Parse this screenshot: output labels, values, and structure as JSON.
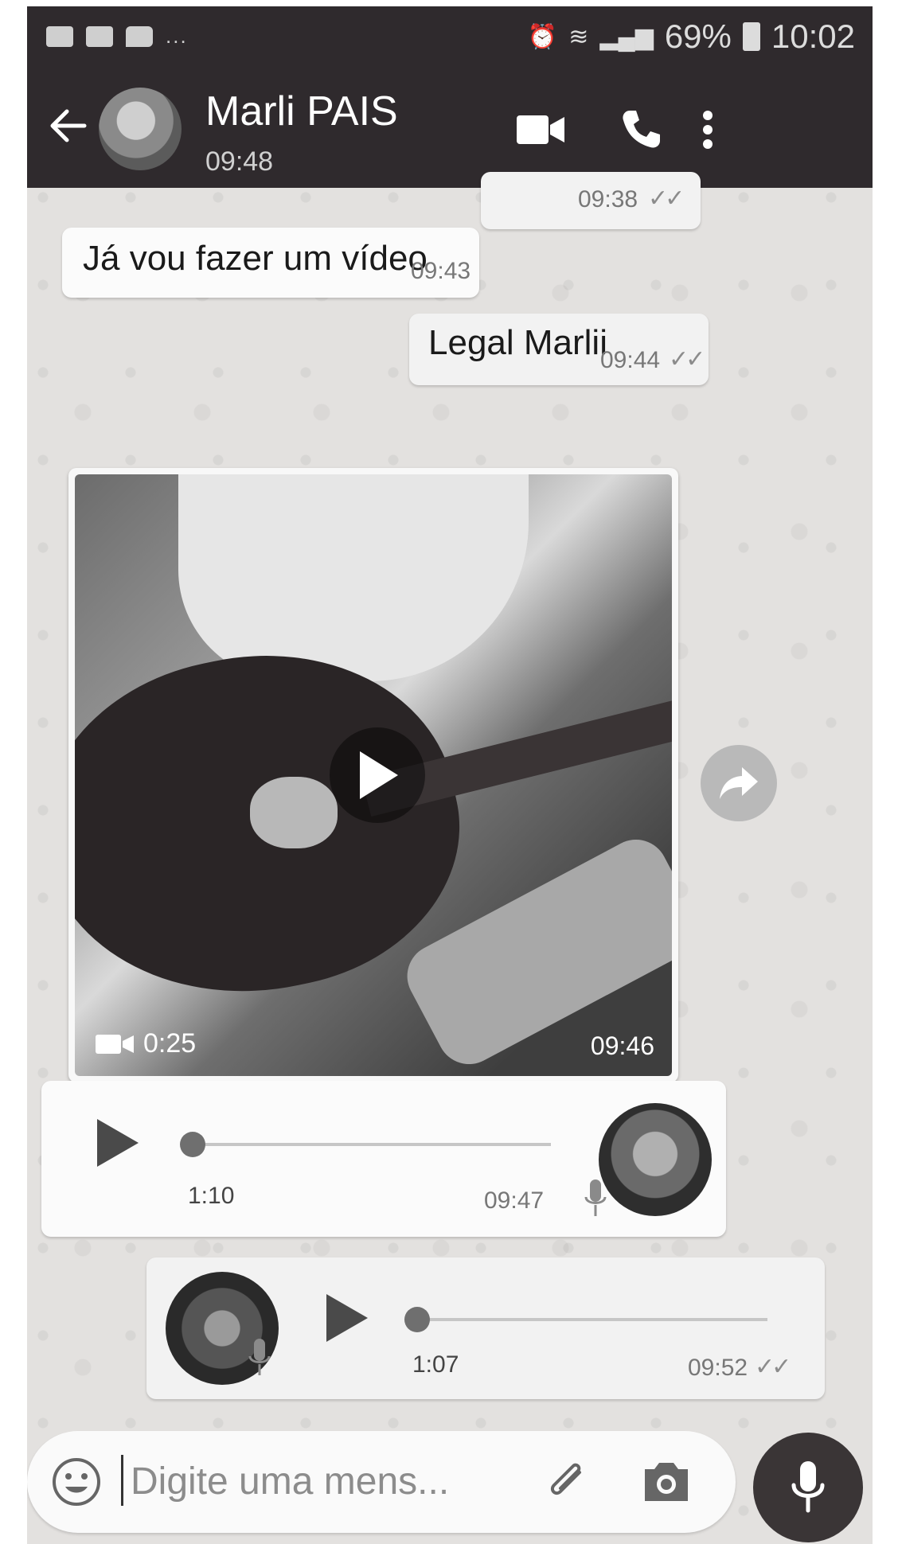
{
  "status_bar": {
    "icons_left": [
      "video-notification-icon",
      "image-notification-icon",
      "message-notification-icon"
    ],
    "overflow": "...",
    "battery": "69%",
    "time": "10:02"
  },
  "header": {
    "contact_name": "Marli PAIS",
    "last_seen": "09:48"
  },
  "messages": {
    "prev_time": "09:38",
    "m1": {
      "text": "Já vou fazer um vídeo",
      "time": "09:43"
    },
    "m2": {
      "text": "Legal Marlii",
      "time": "09:44"
    },
    "video": {
      "duration": "0:25",
      "time": "09:46"
    },
    "voice_in": {
      "duration": "1:10",
      "time": "09:47",
      "progress": 0
    },
    "voice_out": {
      "duration": "1:07",
      "time": "09:52",
      "progress": 0
    }
  },
  "input": {
    "placeholder": "Digite uma mens..."
  }
}
